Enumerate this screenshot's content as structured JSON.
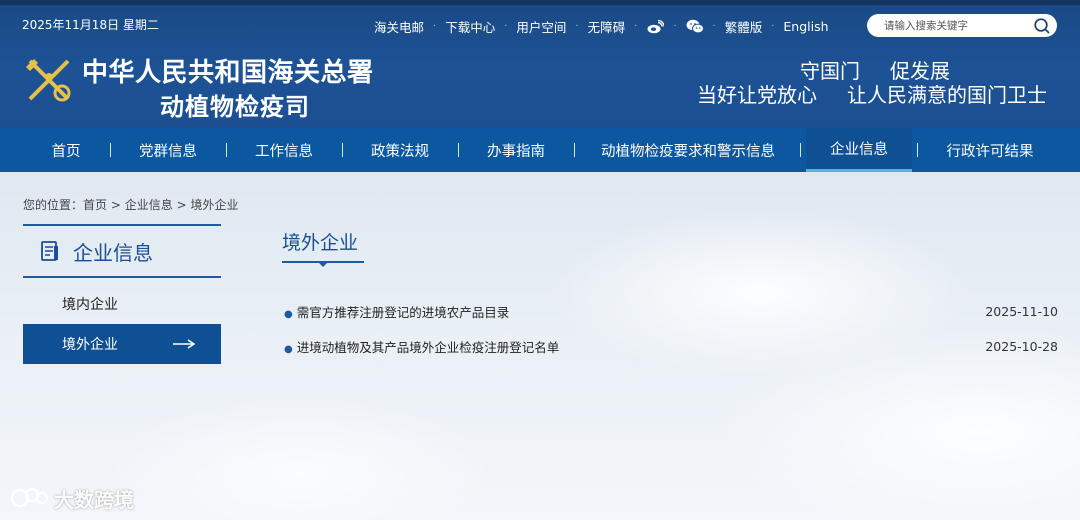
{
  "header": {
    "date": "2025年11月18日 星期二",
    "top_links": [
      "海关电邮",
      "下载中心",
      "用户空间",
      "无障碍"
    ],
    "traditional": "繁體版",
    "english": "English",
    "search_placeholder": "请输入搜索关键字",
    "org_line1": "中华人民共和国海关总署",
    "org_line2": "动植物检疫司",
    "slogan_line1": [
      "守国门",
      "促发展"
    ],
    "slogan_line2": [
      "当好让党放心",
      "让人民满意的国门卫士"
    ]
  },
  "nav": [
    {
      "label": "首页"
    },
    {
      "label": "党群信息"
    },
    {
      "label": "工作信息"
    },
    {
      "label": "政策法规"
    },
    {
      "label": "办事指南"
    },
    {
      "label": "动植物检疫要求和警示信息"
    },
    {
      "label": "企业信息"
    },
    {
      "label": "行政许可结果"
    }
  ],
  "breadcrumb": {
    "prefix": "您的位置：",
    "items": [
      "首页",
      "企业信息",
      "境外企业"
    ],
    "sep": ">"
  },
  "sidebar": {
    "title": "企业信息",
    "items": [
      {
        "label": "境内企业"
      },
      {
        "label": "境外企业"
      }
    ]
  },
  "main": {
    "title": "境外企业",
    "list": [
      {
        "title": "需官方推荐注册登记的进境农产品目录",
        "date": "2025-11-10"
      },
      {
        "title": "进境动植物及其产品境外企业检疫注册登记名单",
        "date": "2025-10-28"
      }
    ]
  },
  "watermark": "大数跨境",
  "colors": {
    "header": "#1d5295",
    "nav": "#0b57a0",
    "accent": "#0f4f93",
    "active_underline": "#52b4e8"
  }
}
